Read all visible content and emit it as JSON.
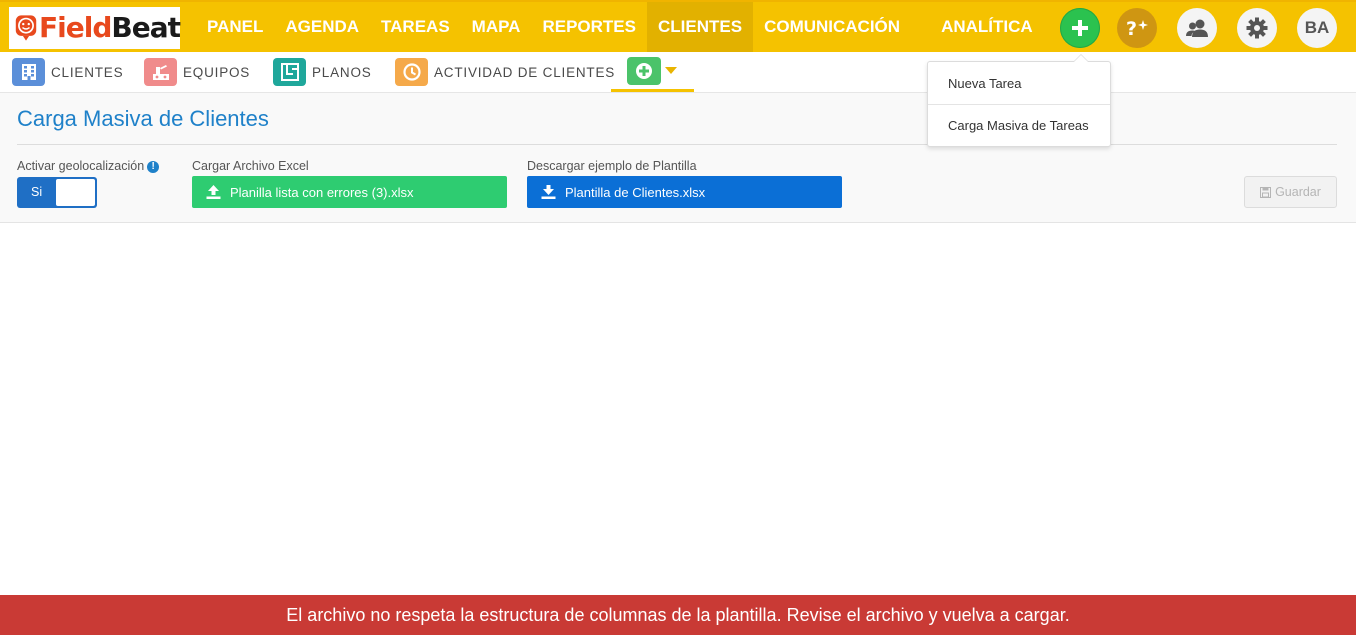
{
  "logo": {
    "part1": "Field",
    "part2": "Beat"
  },
  "mainnav": {
    "items": [
      {
        "label": "PANEL"
      },
      {
        "label": "AGENDA"
      },
      {
        "label": "TAREAS"
      },
      {
        "label": "MAPA"
      },
      {
        "label": "REPORTES"
      },
      {
        "label": "CLIENTES",
        "active": true
      },
      {
        "label": "COMUNICACIÓN"
      },
      {
        "label": "ANALÍTICA"
      }
    ]
  },
  "topbar": {
    "avatar_initials": "BA",
    "icons": [
      "plus-icon",
      "help-sparkle-icon",
      "users-icon",
      "gear-icon"
    ],
    "color": "#f5c200"
  },
  "subnav": {
    "items": [
      {
        "label": "CLIENTES",
        "icon": "building-icon",
        "color": "#5b8fd9"
      },
      {
        "label": "EQUIPOS",
        "icon": "equipment-icon",
        "color": "#f08b8b"
      },
      {
        "label": "PLANOS",
        "icon": "plans-icon",
        "color": "#1fa79b"
      },
      {
        "label": "ACTIVIDAD DE CLIENTES",
        "icon": "clock-icon",
        "color": "#f5a94a"
      }
    ],
    "add_icon_color": "#4bc36a"
  },
  "dropdown": {
    "items": [
      {
        "label": "Nueva Tarea"
      },
      {
        "label": "Carga Masiva de Tareas"
      }
    ]
  },
  "page": {
    "title": "Carga Masiva de Clientes",
    "geo_label": "Activar geolocalización",
    "geo_info": "!",
    "geo_toggle_text": "Si",
    "upload_label": "Cargar Archivo Excel",
    "upload_file": "Planilla lista con errores (3).xlsx",
    "download_label": "Descargar ejemplo de Plantilla",
    "download_file": "Plantilla de Clientes.xlsx",
    "save_label": "Guardar"
  },
  "error": {
    "message": "El archivo no respeta la estructura de columnas de la plantilla. Revise el archivo y vuelva a cargar.",
    "color": "#c93a35"
  }
}
